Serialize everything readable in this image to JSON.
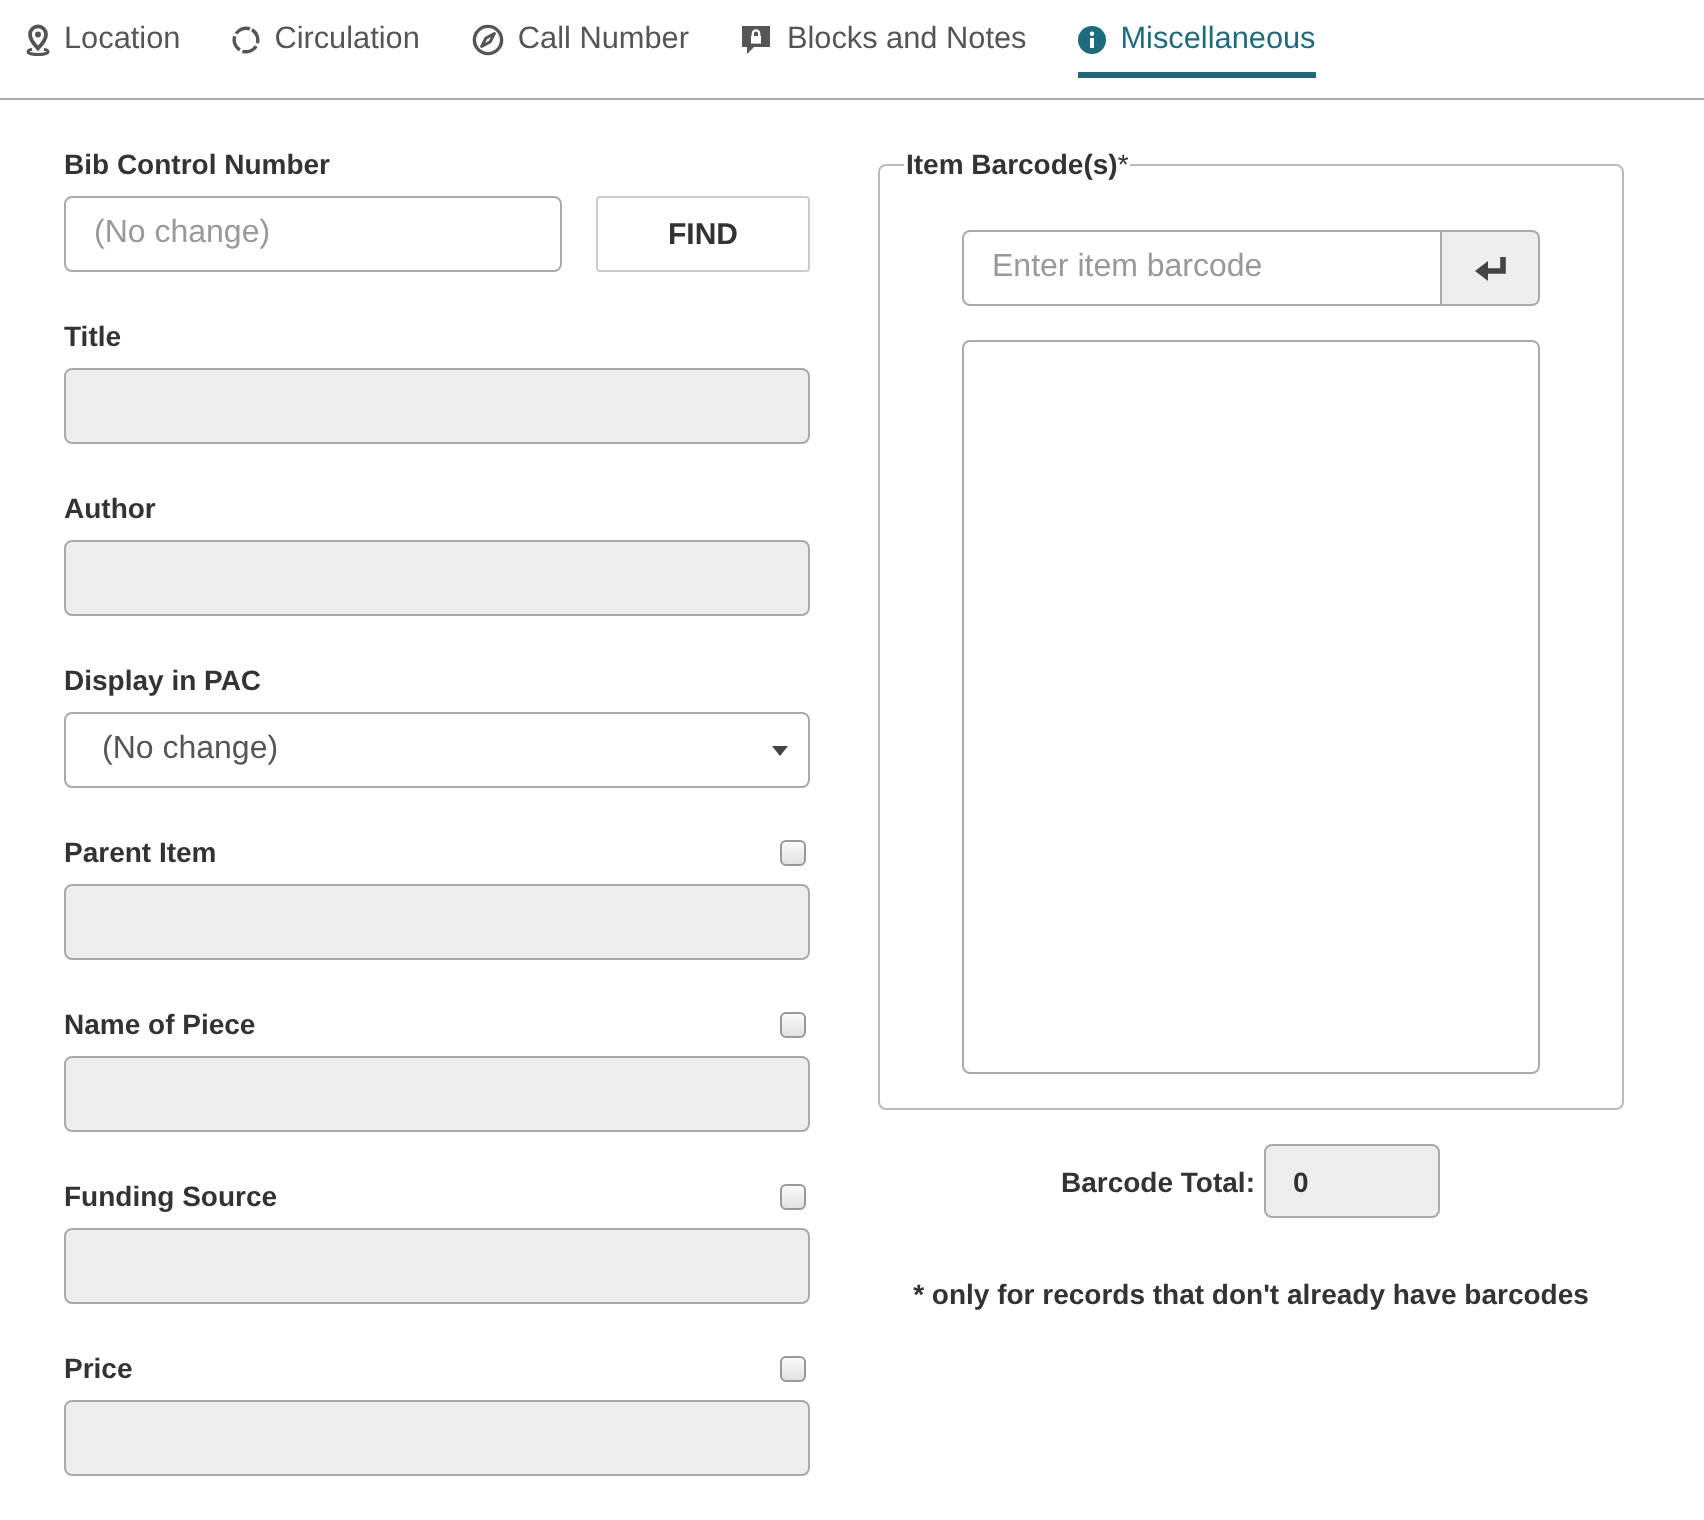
{
  "tabs": [
    {
      "label": "Location",
      "selected": false
    },
    {
      "label": "Circulation",
      "selected": false
    },
    {
      "label": "Call Number",
      "selected": false
    },
    {
      "label": "Blocks and Notes",
      "selected": false
    },
    {
      "label": "Miscellaneous",
      "selected": true
    }
  ],
  "fields": [
    {
      "kind": "lookup",
      "label": "Bib Control Number",
      "placeholder": "(No change)",
      "button": "FIND",
      "disabled": false
    },
    {
      "kind": "text",
      "label": "Title",
      "disabled": true
    },
    {
      "kind": "text",
      "label": "Author",
      "disabled": true
    },
    {
      "kind": "select",
      "label": "Display in PAC",
      "value": "(No change)",
      "disabled": false
    },
    {
      "kind": "text",
      "label": "Parent Item",
      "disabled": true,
      "checked": false
    },
    {
      "kind": "text",
      "label": "Name of Piece",
      "disabled": true,
      "checked": false
    },
    {
      "kind": "text",
      "label": "Funding Source",
      "disabled": true,
      "checked": false
    },
    {
      "kind": "text",
      "label": "Price",
      "disabled": true,
      "checked": false
    }
  ],
  "barcodes": {
    "legend": "Item Barcode(s)",
    "required_mark": "*",
    "placeholder": "Enter item barcode",
    "total_label": "Barcode Total:",
    "total": "0",
    "footnote": "* only for records that don't already have barcodes"
  }
}
